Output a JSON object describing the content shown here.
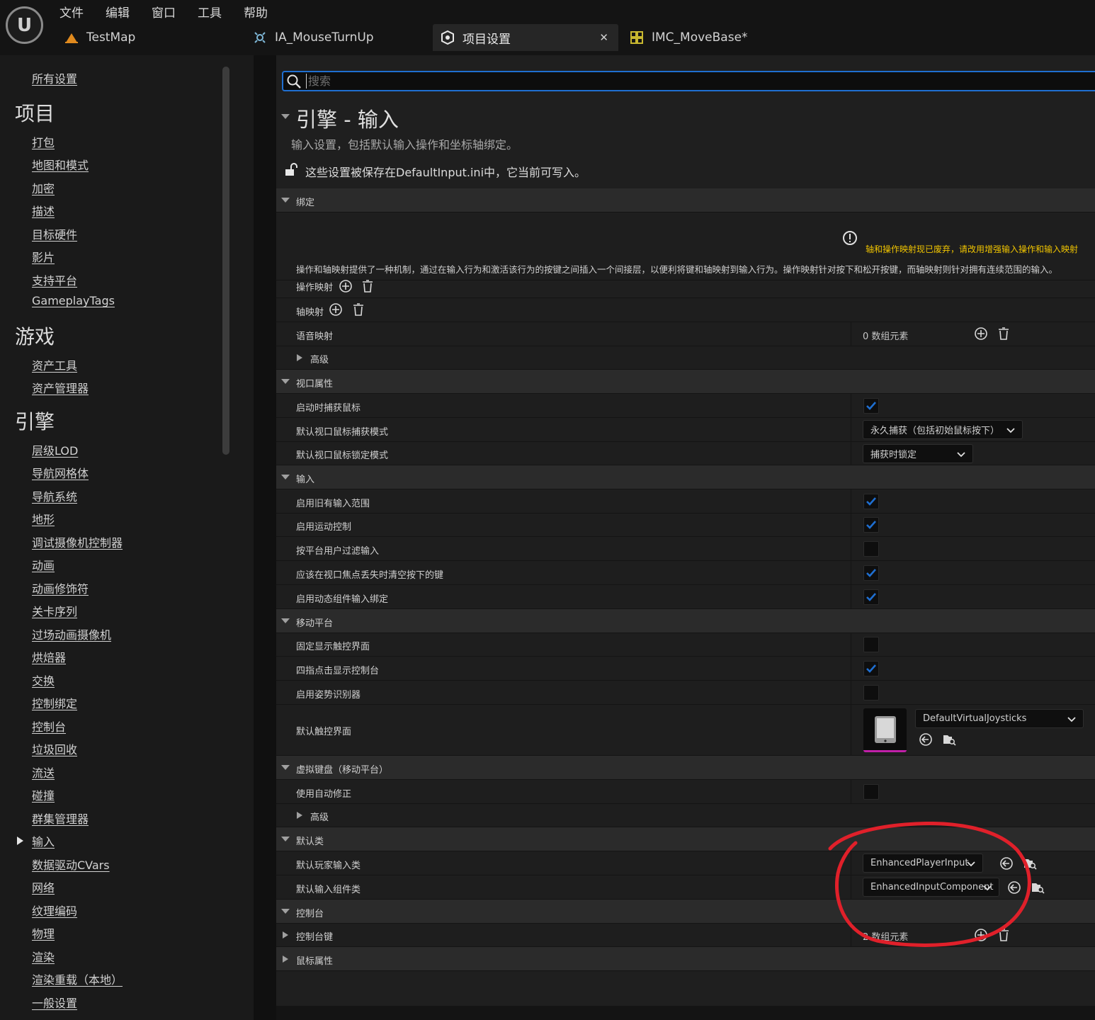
{
  "app": {
    "logo": "U",
    "menu": [
      "文件",
      "编辑",
      "窗口",
      "工具",
      "帮助"
    ]
  },
  "tabs": [
    {
      "label": "TestMap",
      "icon": "map-icon"
    },
    {
      "label": "IA_MouseTurnUp",
      "icon": "input-action-icon"
    },
    {
      "label": "项目设置",
      "icon": "settings-icon",
      "active": true
    },
    {
      "label": "IMC_MoveBase*",
      "icon": "mapping-context-icon"
    }
  ],
  "nav": {
    "all": "所有设置",
    "project_head": "项目",
    "project": [
      "打包",
      "地图和模式",
      "加密",
      "描述",
      "目标硬件",
      "影片",
      "支持平台",
      "GameplayTags"
    ],
    "game_head": "游戏",
    "game": [
      "资产工具",
      "资产管理器"
    ],
    "engine_head": "引擎",
    "engine": [
      "层级LOD",
      "导航网格体",
      "导航系统",
      "地形",
      "调试摄像机控制器",
      "动画",
      "动画修饰符",
      "关卡序列",
      "过场动画摄像机",
      "烘焙器",
      "交换",
      "控制绑定",
      "控制台",
      "垃圾回收",
      "流送",
      "碰撞",
      "群集管理器",
      "输入",
      "数据驱动CVars",
      "网络",
      "纹理编码",
      "物理",
      "渲染",
      "渲染重载（本地）",
      "一般设置"
    ]
  },
  "search": {
    "placeholder": "搜索"
  },
  "section": {
    "title": "引擎 - 输入",
    "desc": "输入设置，包括默认输入操作和坐标轴绑定。",
    "save": "这些设置被保存在DefaultInput.ini中，它当前可写入。"
  },
  "bindings": {
    "cat": "绑定",
    "warning": "轴和操作映射现已废弃，请改用增强输入操作和输入映射",
    "desc": "操作和轴映射提供了一种机制，通过在输入行为和激活该行为的按键之间插入一个间接层，以便利将键和轴映射到输入行为。操作映射针对按下和松开按键，而轴映射则针对拥有连续范围的输入。",
    "action_map": "操作映射",
    "axis_map": "轴映射",
    "speech_map": "语音映射",
    "speech_count": "0 数组元素",
    "advanced": "高级"
  },
  "viewport": {
    "cat": "视口属性",
    "capture_on_start": "启动时捕获鼠标",
    "capture_mode_label": "默认视口鼠标捕获模式",
    "capture_mode_value": "永久捕获（包括初始鼠标按下）",
    "lock_mode_label": "默认视口鼠标锁定模式",
    "lock_mode_value": "捕获时锁定"
  },
  "input": {
    "cat": "输入",
    "legacy_scope": "启用旧有输入范围",
    "motion": "启用运动控制",
    "filter_platform": "按平台用户过滤输入",
    "flush_keys": "应该在视口焦点丢失时清空按下的键",
    "dynamic_binding": "启用动态组件输入绑定"
  },
  "mobile": {
    "cat": "移动平台",
    "always_show_touch": "固定显示触控界面",
    "four_finger": "四指点击显示控制台",
    "gesture": "启用姿势识别器",
    "default_touch_label": "默认触控界面",
    "default_touch_value": "DefaultVirtualJoysticks"
  },
  "vkeyboard": {
    "cat": "虚拟键盘（移动平台）",
    "autocorrect": "使用自动修正",
    "advanced": "高级"
  },
  "defaults": {
    "cat": "默认类",
    "player_input_label": "默认玩家输入类",
    "player_input_value": "EnhancedPlayerInput",
    "input_comp_label": "默认输入组件类",
    "input_comp_value": "EnhancedInputComponent"
  },
  "console": {
    "cat": "控制台",
    "keys_label": "控制台键",
    "keys_count": "2 数组元素"
  },
  "mouse": {
    "cat": "鼠标属性"
  },
  "checks": {
    "capture_on_start": true,
    "legacy_scope": true,
    "motion": true,
    "filter_platform": false,
    "flush_keys": true,
    "dynamic_binding": true,
    "always_show_touch": false,
    "four_finger": true,
    "gesture": false,
    "autocorrect": false
  },
  "colors": {
    "accent": "#1f6fd1",
    "warning": "#f0c400",
    "annotation": "#e0202a",
    "asset": "#c020a8"
  }
}
